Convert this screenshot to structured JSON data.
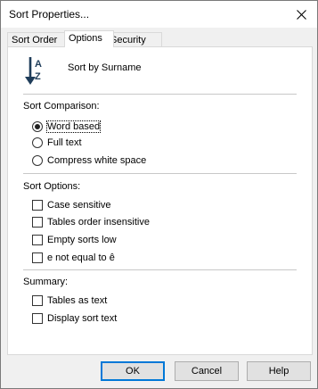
{
  "window": {
    "title": "Sort Properties..."
  },
  "tabs": [
    {
      "label": "Sort Order"
    },
    {
      "label": "Options"
    },
    {
      "label": "Security"
    }
  ],
  "header": {
    "icon": "sort-a-z-icon",
    "label": "Sort by Surname"
  },
  "sort_comparison": {
    "title": "Sort Comparison:",
    "options": [
      {
        "label": "Word based",
        "selected": true
      },
      {
        "label": "Full text",
        "selected": false
      },
      {
        "label": "Compress white space",
        "selected": false
      }
    ]
  },
  "sort_options": {
    "title": "Sort Options:",
    "options": [
      {
        "label": "Case sensitive",
        "checked": false
      },
      {
        "label": "Tables order insensitive",
        "checked": false
      },
      {
        "label": "Empty sorts low",
        "checked": false
      },
      {
        "label": "e not equal to ê",
        "checked": false
      }
    ]
  },
  "summary": {
    "title": "Summary:",
    "options": [
      {
        "label": "Tables as text",
        "checked": false
      },
      {
        "label": "Display sort text",
        "checked": false
      }
    ]
  },
  "buttons": {
    "ok": "OK",
    "cancel": "Cancel",
    "help": "Help"
  },
  "colors": {
    "default_button_border": "#0078d7",
    "panel_bg": "#ffffff",
    "dialog_bg": "#f0f0f0"
  }
}
